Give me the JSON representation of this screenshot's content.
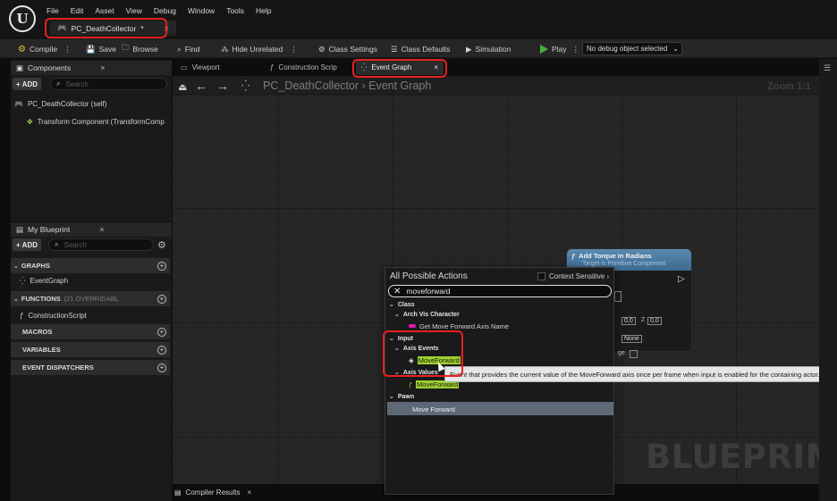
{
  "app": {
    "logo": "U"
  },
  "menu": [
    "File",
    "Edit",
    "Asset",
    "View",
    "Debug",
    "Window",
    "Tools",
    "Help"
  ],
  "asset_tab": {
    "label": "PC_DeathCollector",
    "modified": "*",
    "close": "×"
  },
  "toolbar": {
    "compile": "Compile",
    "save": "Save",
    "browse": "Browse",
    "find": "Find",
    "hide_unrelated": "Hide Unrelated",
    "class_settings": "Class Settings",
    "class_defaults": "Class Defaults",
    "simulation": "Simulation",
    "play": "Play",
    "debug_object": "No debug object selected"
  },
  "components": {
    "title": "Components",
    "add": "ADD",
    "search_placeholder": "Search",
    "items": [
      "PC_DeathCollector (self)",
      "Transform Component (TransformComp"
    ]
  },
  "my_blueprint": {
    "title": "My Blueprint",
    "add": "ADD",
    "search_placeholder": "Search",
    "graphs_label": "GRAPHS",
    "graph_item": "EventGraph",
    "functions_label": "FUNCTIONS",
    "functions_sub": "(21 OVERRIDABL",
    "function_item": "ConstructionScript",
    "macros_label": "MACROS",
    "variables_label": "VARIABLES",
    "dispatchers_label": "EVENT DISPATCHERS"
  },
  "graph_tabs": [
    "Viewport",
    "Construction Scrip",
    "Event Graph"
  ],
  "breadcrumb": {
    "blueprint": "PC_DeathCollector",
    "graph": "Event Graph"
  },
  "zoom": "Zoom 1:1",
  "watermark": "BLUEPRINT",
  "node": {
    "title": "Add Torque in Radians",
    "subtitle": "Target is Primitive Component"
  },
  "node_pins": {
    "vec_x": "0,0",
    "vec_z_label": "Z",
    "vec_z": "0,0",
    "none": "None",
    "age": "ge"
  },
  "actions_popup": {
    "title": "All Possible Actions",
    "context_sensitive": "Context Sensitive",
    "search_value": "moveforward",
    "cat_class": "Class",
    "cat_arch": "Arch Vis Character",
    "item_get_axis": "Get Move Forward Axis Name",
    "cat_input": "Input",
    "cat_axis_events": "Axis Events",
    "item_axis_event": "MoveForward",
    "cat_axis_values": "Axis Values",
    "item_axis_value": "MoveForward",
    "cat_pawn": "Pawn",
    "item_move_forward": "Move Forward"
  },
  "tooltip": "Event that provides the current value of the MoveForward axis once per frame when input is enabled for the containing actor.",
  "bottom_tab": "Compiler Results",
  "colors": {
    "highlight": "#e82020",
    "match": "#9dd12e",
    "play": "#42b43a",
    "node_header": "#4a7aa0"
  }
}
